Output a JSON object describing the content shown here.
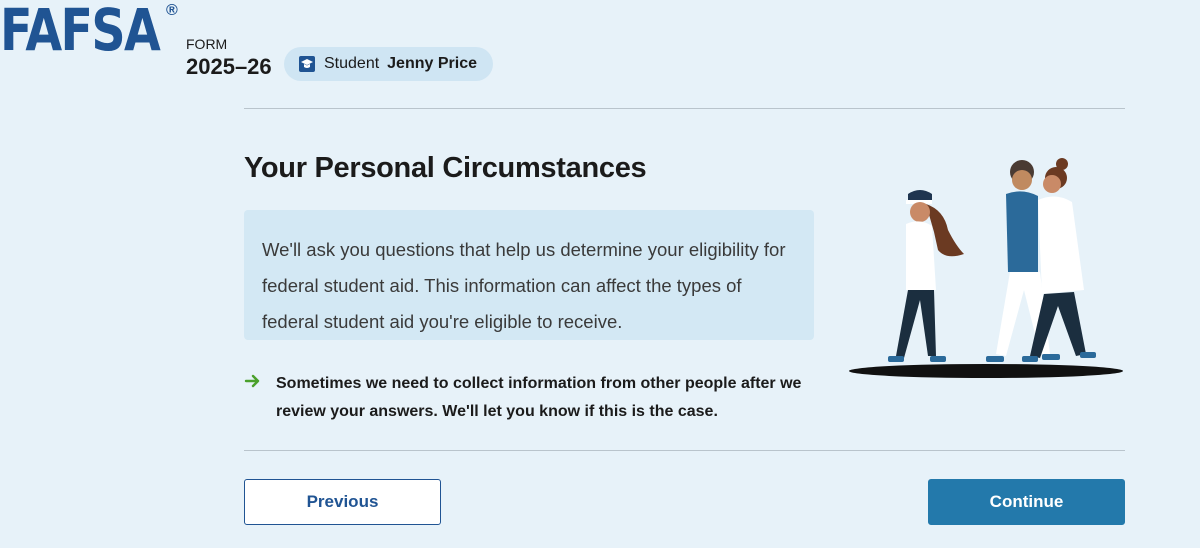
{
  "header": {
    "logo": "FAFSA",
    "registered": "®",
    "form_label": "FORM",
    "form_year": "2025–26",
    "user_role": "Student",
    "user_name": "Jenny Price",
    "user_icon": "graduation-cap-icon"
  },
  "main": {
    "title": "Your Personal Circumstances",
    "info": "We'll ask you questions that help us determine your eligibility for federal student aid. This information can affect the types of federal student aid you're eligible to receive.",
    "note": "Sometimes we need to collect information from other people after we review your answers. We'll let you know if this is the case.",
    "note_icon": "arrow-right-icon"
  },
  "actions": {
    "previous_label": "Previous",
    "continue_label": "Continue"
  },
  "colors": {
    "brand": "#205493",
    "background": "#e7f2f9",
    "info_box": "#d3e8f4",
    "primary_button": "#2379ab",
    "arrow": "#4aa02c"
  }
}
